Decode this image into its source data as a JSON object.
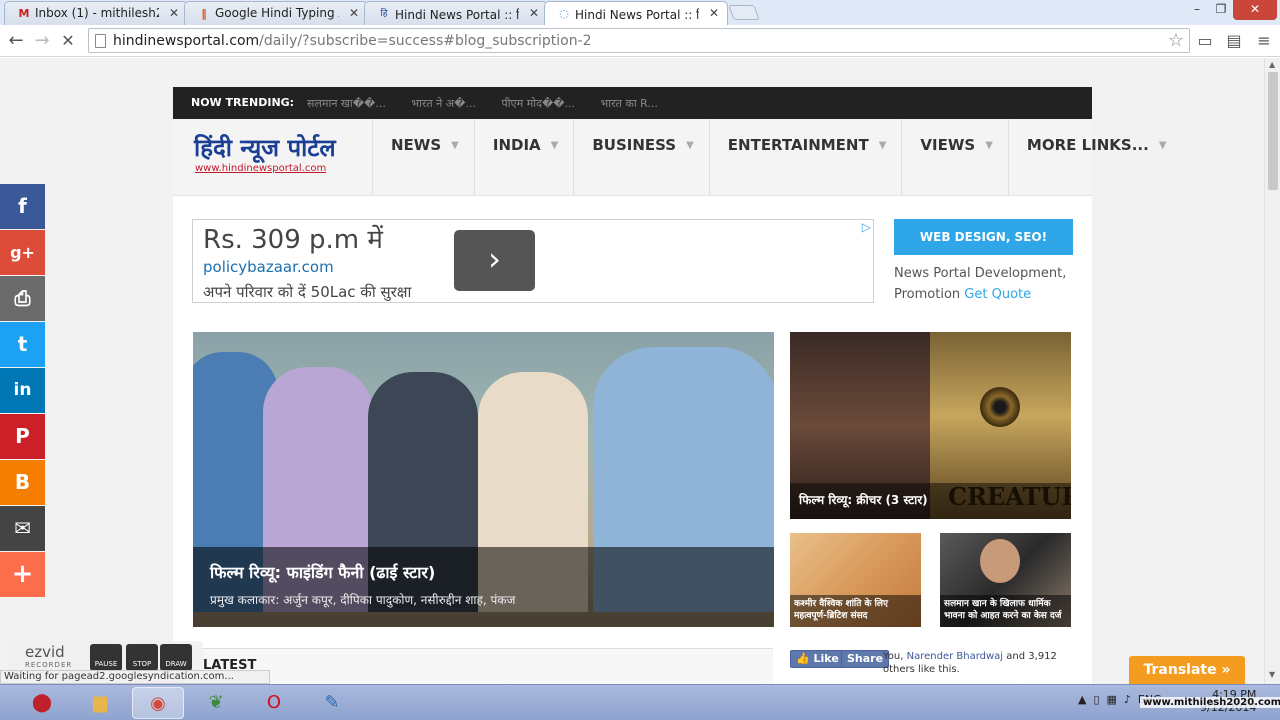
{
  "browser": {
    "tabs": [
      {
        "title": "Inbox (1) - mithilesh2020@",
        "favicon": "gmail-icon"
      },
      {
        "title": "Google Hindi Typing API",
        "favicon": "blogger-icon"
      },
      {
        "title": "Hindi News Portal :: हिन्दी",
        "favicon": "site-icon"
      },
      {
        "title": "Hindi News Portal :: हिन्दी",
        "favicon": "loading-icon"
      }
    ],
    "url_host": "hindinewsportal.com",
    "url_path": "/daily/?subscribe=success#blog_subscription-2",
    "status_text": "Waiting for pagead2.googlesyndication.com..."
  },
  "site": {
    "trending_label": "NOW TRENDING:",
    "trending_items": [
      "सलमान खा��...",
      "भारत ने अ�...",
      "पीएम मोद��...",
      "भारत का R..."
    ],
    "logo_text": "हिंदी न्यूज पोर्टल",
    "logo_url": "www.hindinewsportal.com",
    "nav": [
      "NEWS",
      "INDIA",
      "BUSINESS",
      "ENTERTAINMENT",
      "VIEWS",
      "MORE LINKS..."
    ],
    "ad": {
      "price": "Rs. 309 p.m में",
      "domain": "policybazaar.com",
      "desc": "अपने परिवार को दें 50Lac की सुरक्षा",
      "go": "›"
    },
    "promo": {
      "button": "WEB DESIGN, SEO!",
      "text": "News Portal Development, Promotion",
      "link": "Get Quote"
    },
    "hero": {
      "title": "फिल्म रिव्यू: फाइंडिंग फैनी (ढाई स्टार)",
      "subtitle": "प्रमुख कलाकार: अर्जुन कपूर, दीपिका पादुकोण, नसीरुद्दीन शाह, पंकज"
    },
    "side1_caption": "फिल्म रिव्यू: क्रीचर (3 स्टार)",
    "side1_poster_text": "CREATURE",
    "side2_caption": "कश्मीर वैश्विक शांति के लिए महत्वपूर्ण-ब्रिटिश संसद",
    "side3_caption": "सलमान खान के खिलाफ धार्मिक भावना को आहत करने का केस दर्ज",
    "latest_label": "LATEST",
    "fb": {
      "like": "Like",
      "share": "Share",
      "you": "You,",
      "name": "Narender Bhardwaj",
      "rest": "and 3,912 others like this."
    },
    "translate": "Translate »"
  },
  "share_bar": [
    {
      "icon": "facebook-icon",
      "glyph": "f",
      "color": "#3b5998"
    },
    {
      "icon": "google-plus-icon",
      "glyph": "g+",
      "color": "#dd4b39"
    },
    {
      "icon": "print-icon",
      "glyph": "⎙",
      "color": "#6b6b6b"
    },
    {
      "icon": "twitter-icon",
      "glyph": "t",
      "color": "#1da1f2"
    },
    {
      "icon": "linkedin-icon",
      "glyph": "in",
      "color": "#0077b5"
    },
    {
      "icon": "pinterest-icon",
      "glyph": "P",
      "color": "#cb2027"
    },
    {
      "icon": "blogger-icon",
      "glyph": "B",
      "color": "#f57d00"
    },
    {
      "icon": "email-icon",
      "glyph": "✉",
      "color": "#444444"
    },
    {
      "icon": "more-icon",
      "glyph": "+",
      "color": "#fc6d4c"
    }
  ],
  "ezvid": {
    "logo": "ezvid",
    "sub": "RECORDER",
    "controls": [
      "PAUSE",
      "STOP",
      "DRAW"
    ]
  },
  "taskbar": {
    "time": "4:19 PM",
    "date": "9/12/2014",
    "lang": "ENG",
    "watermark": "www.mithilesh2020.com"
  }
}
